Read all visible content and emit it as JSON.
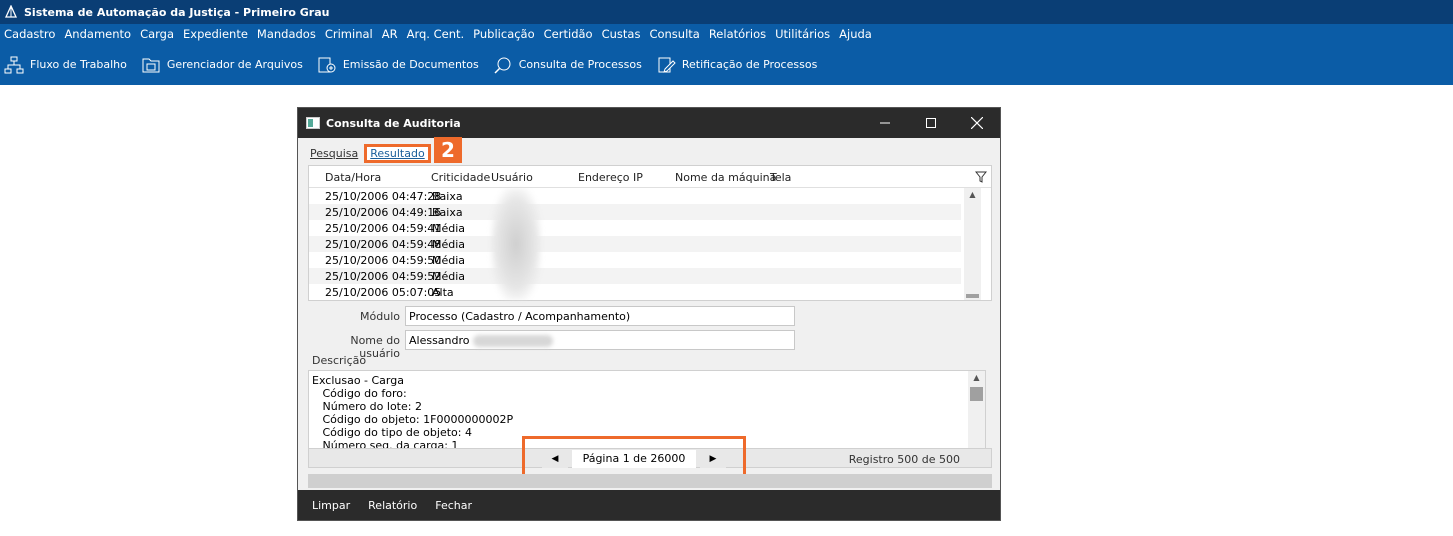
{
  "app": {
    "title": "Sistema de Automação da Justiça - Primeiro Grau"
  },
  "menu": [
    "Cadastro",
    "Andamento",
    "Carga",
    "Expediente",
    "Mandados",
    "Criminal",
    "AR",
    "Arq. Cent.",
    "Publicação",
    "Certidão",
    "Custas",
    "Consulta",
    "Relatórios",
    "Utilitários",
    "Ajuda"
  ],
  "toolbar": [
    {
      "label": "Fluxo de Trabalho",
      "icon": "workflow-icon"
    },
    {
      "label": "Gerenciador de Arquivos",
      "icon": "file-manager-icon"
    },
    {
      "label": "Emissão de Documentos",
      "icon": "document-issue-icon"
    },
    {
      "label": "Consulta de Processos",
      "icon": "process-search-icon"
    },
    {
      "label": "Retificação de Processos",
      "icon": "edit-process-icon"
    }
  ],
  "dialog": {
    "title": "Consulta de Auditoria",
    "tabs": [
      "Pesquisa",
      "Resultado"
    ],
    "active_tab": "Resultado",
    "step_badge": "2",
    "columns": [
      "Data/Hora",
      "Criticidade",
      "Usuário",
      "Endereço IP",
      "Nome da máquina",
      "Tela"
    ],
    "rows": [
      {
        "date": "25/10/2006 04:47:28",
        "crit": "Baixa"
      },
      {
        "date": "25/10/2006 04:49:16",
        "crit": "Baixa"
      },
      {
        "date": "25/10/2006 04:59:41",
        "crit": "Média"
      },
      {
        "date": "25/10/2006 04:59:48",
        "crit": "Média"
      },
      {
        "date": "25/10/2006 04:59:50",
        "crit": "Média"
      },
      {
        "date": "25/10/2006 04:59:52",
        "crit": "Média"
      },
      {
        "date": "25/10/2006 05:07:05",
        "crit": "Alta"
      }
    ],
    "modulo_label": "Módulo",
    "modulo_value": "Processo (Cadastro / Acompanhamento)",
    "usuario_label": "Nome do usuário",
    "usuario_value": "Alessandro",
    "descricao_label": "Descrição",
    "descricao_lines": [
      "Exclusao - Carga",
      "   Código do foro:",
      "   Número do lote: 2",
      "   Código do objeto: 1F0000000002P",
      "   Código do tipo de objeto: 4",
      "   Número seq. da carga: 1"
    ],
    "pager_label": "Página 1 de 26000",
    "registro": "Registro 500 de 500",
    "actions": [
      "Limpar",
      "Relatório",
      "Fechar"
    ]
  },
  "colors": {
    "accent": "#ee6a2b",
    "menubar": "#0b5ca6",
    "titlebar": "#0a3e75"
  }
}
